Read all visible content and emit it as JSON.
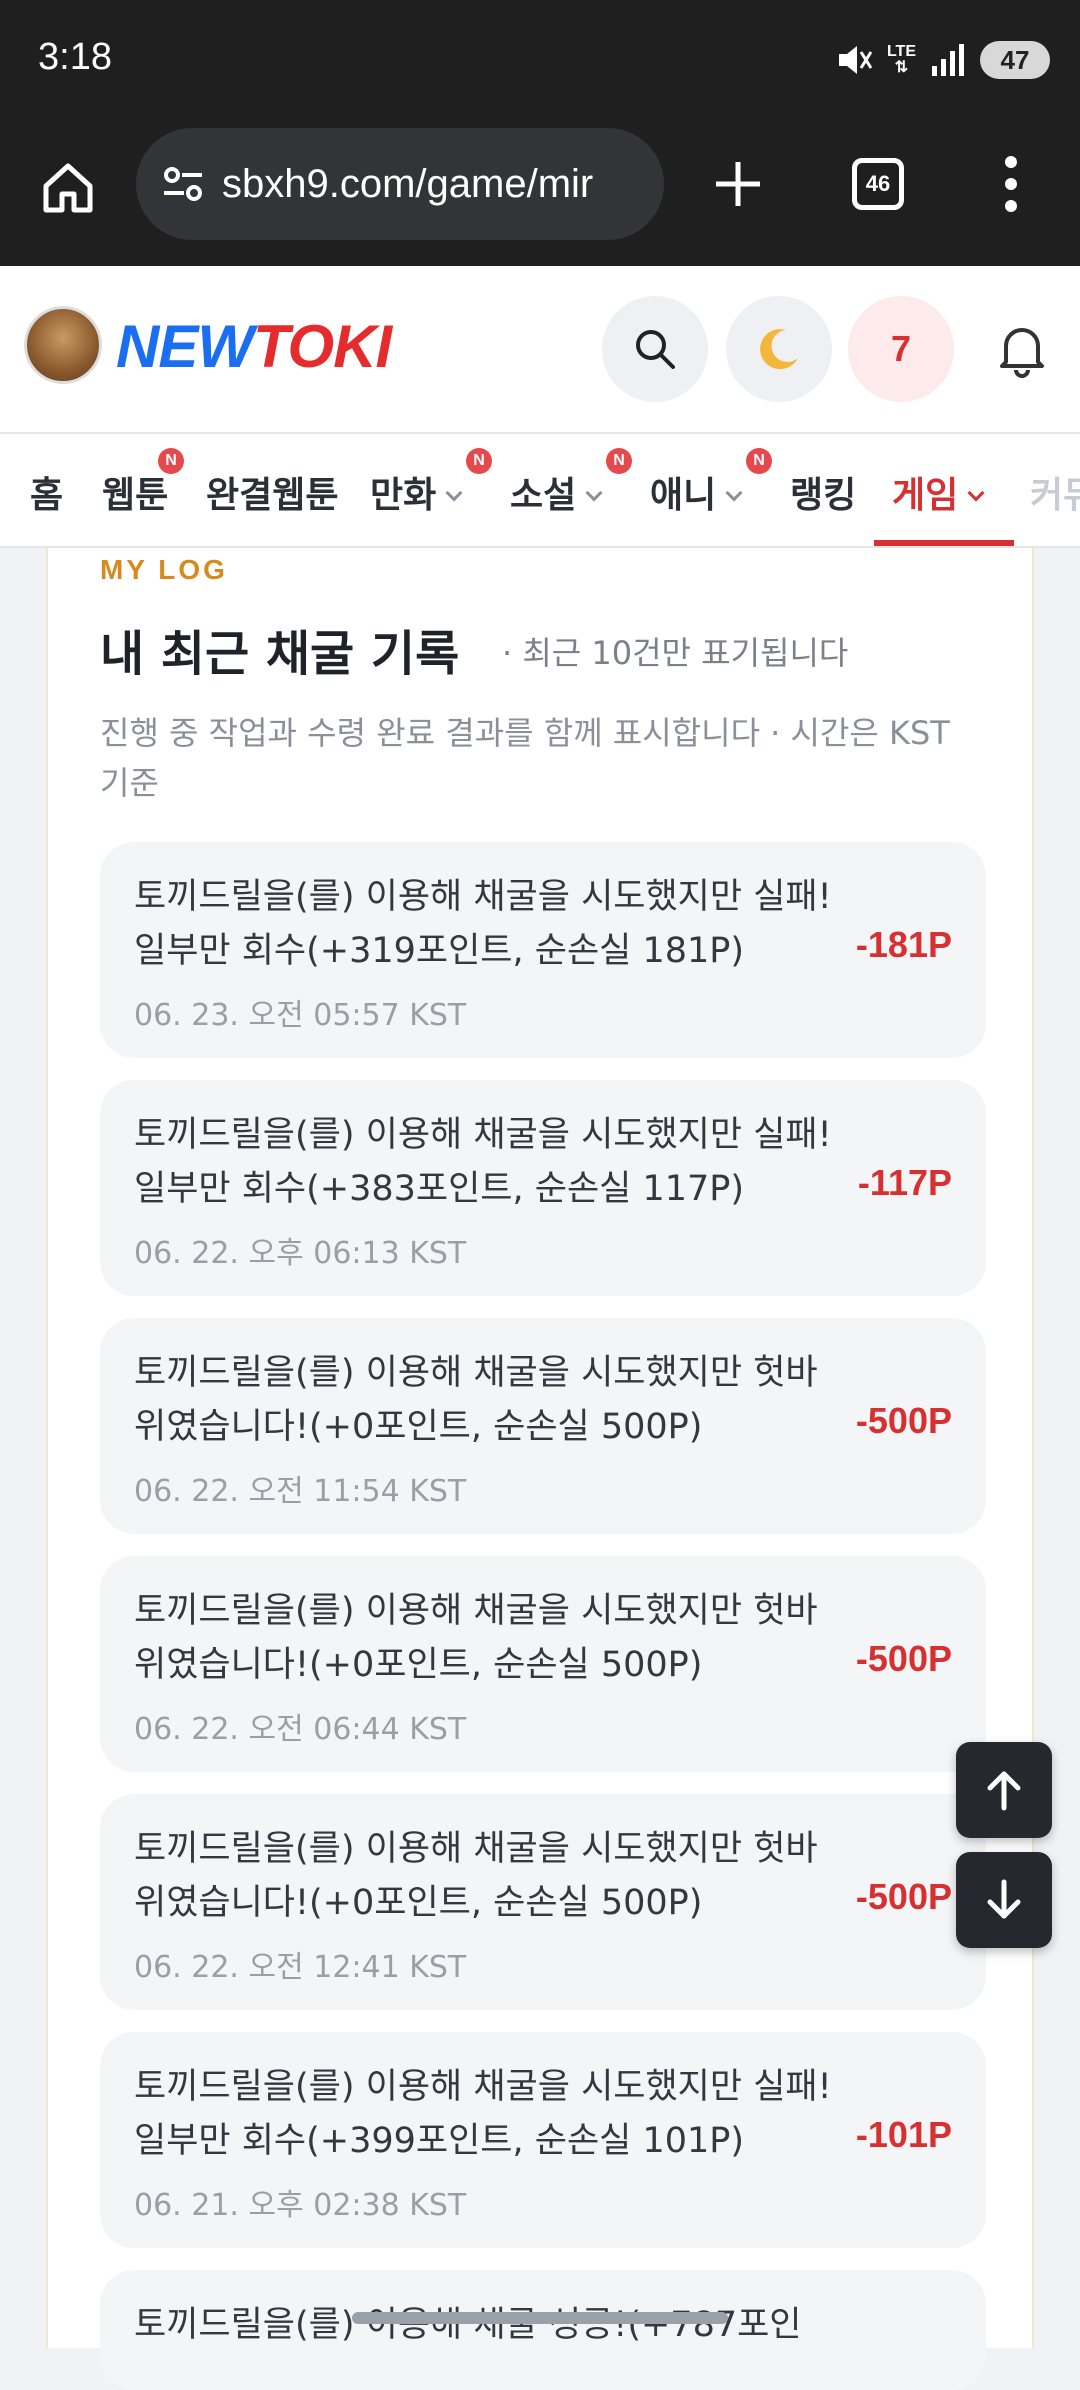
{
  "status_bar": {
    "time": "3:18",
    "network": "LTE",
    "battery": "47"
  },
  "browser": {
    "url": "sbxh9.com/game/mir",
    "tab_count": "46"
  },
  "site": {
    "logo_part1": "NEW",
    "logo_part2": "TOKI",
    "notification_count": "7"
  },
  "nav": {
    "items": [
      {
        "label": "홈"
      },
      {
        "label": "웹툰",
        "badge": "N"
      },
      {
        "label": "완결웹툰"
      },
      {
        "label": "만화",
        "badge": "N"
      },
      {
        "label": "소설",
        "badge": "N"
      },
      {
        "label": "애니",
        "badge": "N"
      },
      {
        "label": "랭킹"
      },
      {
        "label": "게임"
      },
      {
        "label": "커뮤"
      }
    ]
  },
  "log": {
    "eyebrow": "MY LOG",
    "title": "내 최근 채굴 기록",
    "note": "· 최근 10건만 표기됩니다",
    "description": "진행 중 작업과 수령 완료 결과를 함께 표시합니다 · 시간은 KST 기준",
    "entries": [
      {
        "text": "토끼드릴을(를) 이용해 채굴을 시도했지만 실패! 일부만 회수(+319포인트, 순손실 181P)",
        "time": "06. 23. 오전 05:57 KST",
        "amount": "-181P"
      },
      {
        "text": "토끼드릴을(를) 이용해 채굴을 시도했지만 실패! 일부만 회수(+383포인트, 순손실 117P)",
        "time": "06. 22. 오후 06:13 KST",
        "amount": "-117P"
      },
      {
        "text": "토끼드릴을(를) 이용해 채굴을 시도했지만 헛바위였습니다!(+0포인트, 순손실 500P)",
        "time": "06. 22. 오전 11:54 KST",
        "amount": "-500P"
      },
      {
        "text": "토끼드릴을(를) 이용해 채굴을 시도했지만 헛바위였습니다!(+0포인트, 순손실 500P)",
        "time": "06. 22. 오전 06:44 KST",
        "amount": "-500P"
      },
      {
        "text": "토끼드릴을(를) 이용해 채굴을 시도했지만 헛바위였습니다!(+0포인트, 순손실 500P)",
        "time": "06. 22. 오전 12:41 KST",
        "amount": "-500P"
      },
      {
        "text": "토끼드릴을(를) 이용해 채굴을 시도했지만 실패! 일부만 회수(+399포인트, 순손실 101P)",
        "time": "06. 21. 오후 02:38 KST",
        "amount": "-101P"
      },
      {
        "text": "토끼드릴을(를) 이용해 채굴 성공!(+787포인",
        "time": "",
        "amount": ""
      }
    ]
  },
  "colors": {
    "accent": "#d63031",
    "eyebrow": "#d98a1c"
  }
}
